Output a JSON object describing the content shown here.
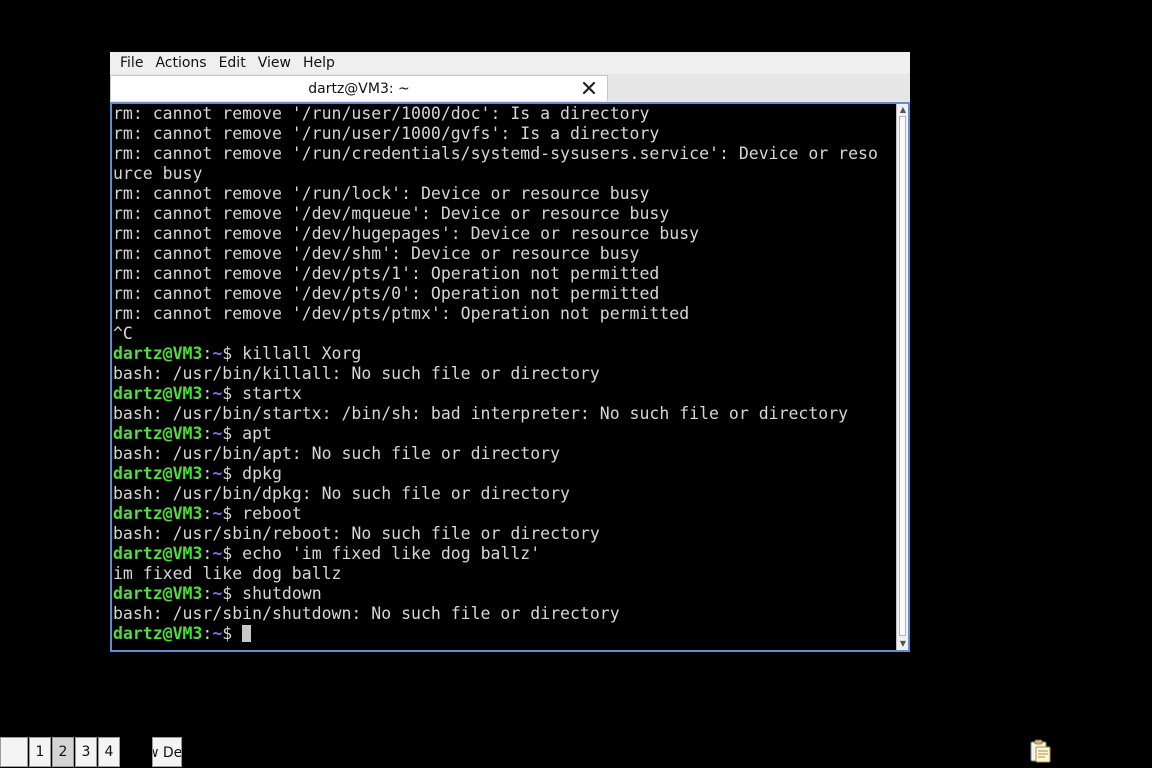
{
  "menubar": {
    "items": [
      "File",
      "Actions",
      "Edit",
      "View",
      "Help"
    ]
  },
  "tab": {
    "title": "dartz@VM3: ~"
  },
  "prompt": {
    "user_host": "dartz@VM3",
    "colon": ":",
    "path": "~",
    "symbol": "$"
  },
  "terminal": {
    "lines": [
      {
        "type": "out",
        "text": "rm: cannot remove '/run/user/1000/doc': Is a directory"
      },
      {
        "type": "out",
        "text": "rm: cannot remove '/run/user/1000/gvfs': Is a directory"
      },
      {
        "type": "out",
        "text": "rm: cannot remove '/run/credentials/systemd-sysusers.service': Device or reso"
      },
      {
        "type": "out",
        "text": "urce busy"
      },
      {
        "type": "out",
        "text": "rm: cannot remove '/run/lock': Device or resource busy"
      },
      {
        "type": "out",
        "text": "rm: cannot remove '/dev/mqueue': Device or resource busy"
      },
      {
        "type": "out",
        "text": "rm: cannot remove '/dev/hugepages': Device or resource busy"
      },
      {
        "type": "out",
        "text": "rm: cannot remove '/dev/shm': Device or resource busy"
      },
      {
        "type": "out",
        "text": "rm: cannot remove '/dev/pts/1': Operation not permitted"
      },
      {
        "type": "out",
        "text": "rm: cannot remove '/dev/pts/0': Operation not permitted"
      },
      {
        "type": "out",
        "text": "rm: cannot remove '/dev/pts/ptmx': Operation not permitted"
      },
      {
        "type": "out",
        "text": "^C"
      },
      {
        "type": "cmd",
        "text": " killall Xorg"
      },
      {
        "type": "out",
        "text": "bash: /usr/bin/killall: No such file or directory"
      },
      {
        "type": "cmd",
        "text": " startx"
      },
      {
        "type": "out",
        "text": "bash: /usr/bin/startx: /bin/sh: bad interpreter: No such file or directory"
      },
      {
        "type": "cmd",
        "text": " apt"
      },
      {
        "type": "out",
        "text": "bash: /usr/bin/apt: No such file or directory"
      },
      {
        "type": "cmd",
        "text": " dpkg"
      },
      {
        "type": "out",
        "text": "bash: /usr/bin/dpkg: No such file or directory"
      },
      {
        "type": "cmd",
        "text": " reboot"
      },
      {
        "type": "out",
        "text": "bash: /usr/sbin/reboot: No such file or directory"
      },
      {
        "type": "cmd",
        "text": " echo 'im fixed like dog ballz'"
      },
      {
        "type": "out",
        "text": "im fixed like dog ballz"
      },
      {
        "type": "cmd",
        "text": " shutdown"
      },
      {
        "type": "out",
        "text": "bash: /usr/sbin/shutdown: No such file or directory"
      },
      {
        "type": "cmd",
        "text": " ",
        "cursor": true
      }
    ]
  },
  "taskbar": {
    "workspaces": [
      "1",
      "2",
      "3",
      "4"
    ],
    "active_workspace": "2",
    "desktop_button_label": "w Des"
  },
  "icons": {
    "tab_close": "close-icon",
    "clipboard": "clipboard-icon"
  },
  "colors": {
    "prompt_user": "#4fdc3c",
    "prompt_path": "#6f78ff",
    "terminal_bg": "#000000",
    "terminal_fg": "#d6d6d6",
    "focus_border": "#5b8fd6"
  }
}
